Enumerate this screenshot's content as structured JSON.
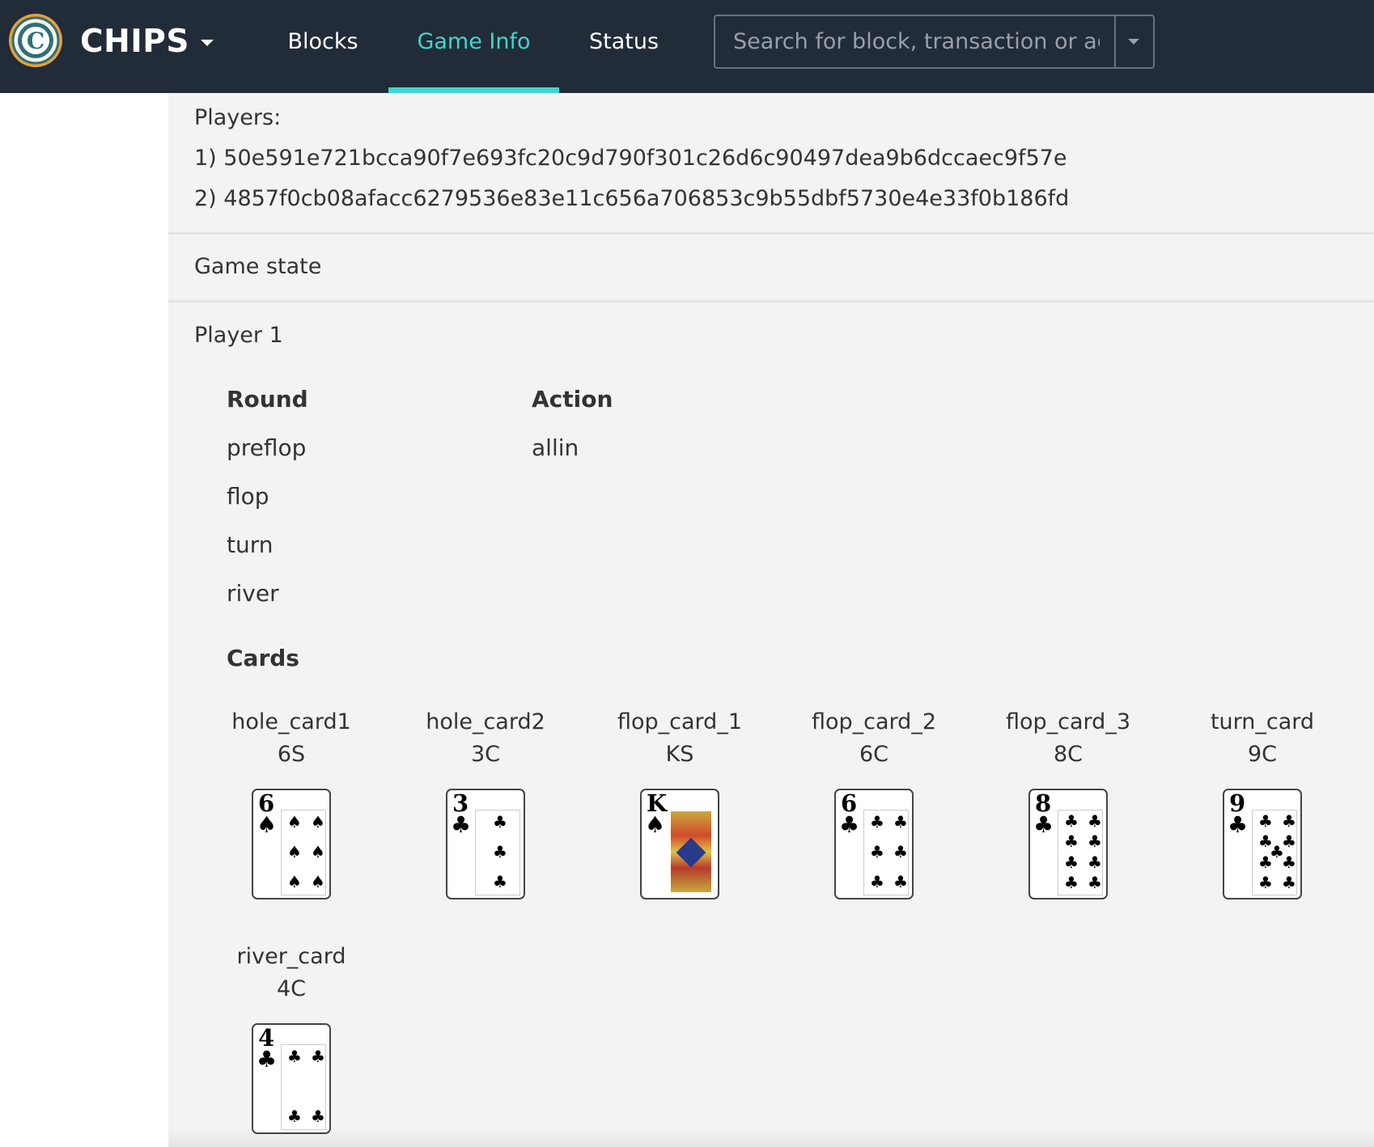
{
  "navbar": {
    "brand": "CHIPS",
    "items": [
      "Blocks",
      "Game Info",
      "Status"
    ],
    "active": "Game Info",
    "search_placeholder": "Search for block, transaction or address",
    "accent_color": "#3fd6cd",
    "background_color": "#222b38"
  },
  "players": {
    "heading": "Players:",
    "list": [
      "1) 50e591e721bcca90f7e693fc20c9d790f301c26d6c90497dea9b6dccaec9f57e",
      "2) 4857f0cb08afacc6279536e83e11c656a706853c9b55dbf5730e4e33f0b186fd"
    ]
  },
  "game_state": {
    "heading": "Game state"
  },
  "player1": {
    "heading": "Player 1",
    "table": {
      "headers": [
        "Round",
        "Action"
      ],
      "rows": [
        [
          "preflop",
          "allin"
        ],
        [
          "flop",
          ""
        ],
        [
          "turn",
          ""
        ],
        [
          "river",
          ""
        ]
      ]
    },
    "cards_heading": "Cards",
    "cards": [
      {
        "name": "hole_card1",
        "value": "6S",
        "rank": "6",
        "suit": "♠"
      },
      {
        "name": "hole_card2",
        "value": "3C",
        "rank": "3",
        "suit": "♣"
      },
      {
        "name": "flop_card_1",
        "value": "KS",
        "rank": "K",
        "suit": "♠"
      },
      {
        "name": "flop_card_2",
        "value": "6C",
        "rank": "6",
        "suit": "♣"
      },
      {
        "name": "flop_card_3",
        "value": "8C",
        "rank": "8",
        "suit": "♣"
      },
      {
        "name": "turn_card",
        "value": "9C",
        "rank": "9",
        "suit": "♣"
      },
      {
        "name": "river_card",
        "value": "4C",
        "rank": "4",
        "suit": "♣"
      }
    ]
  }
}
